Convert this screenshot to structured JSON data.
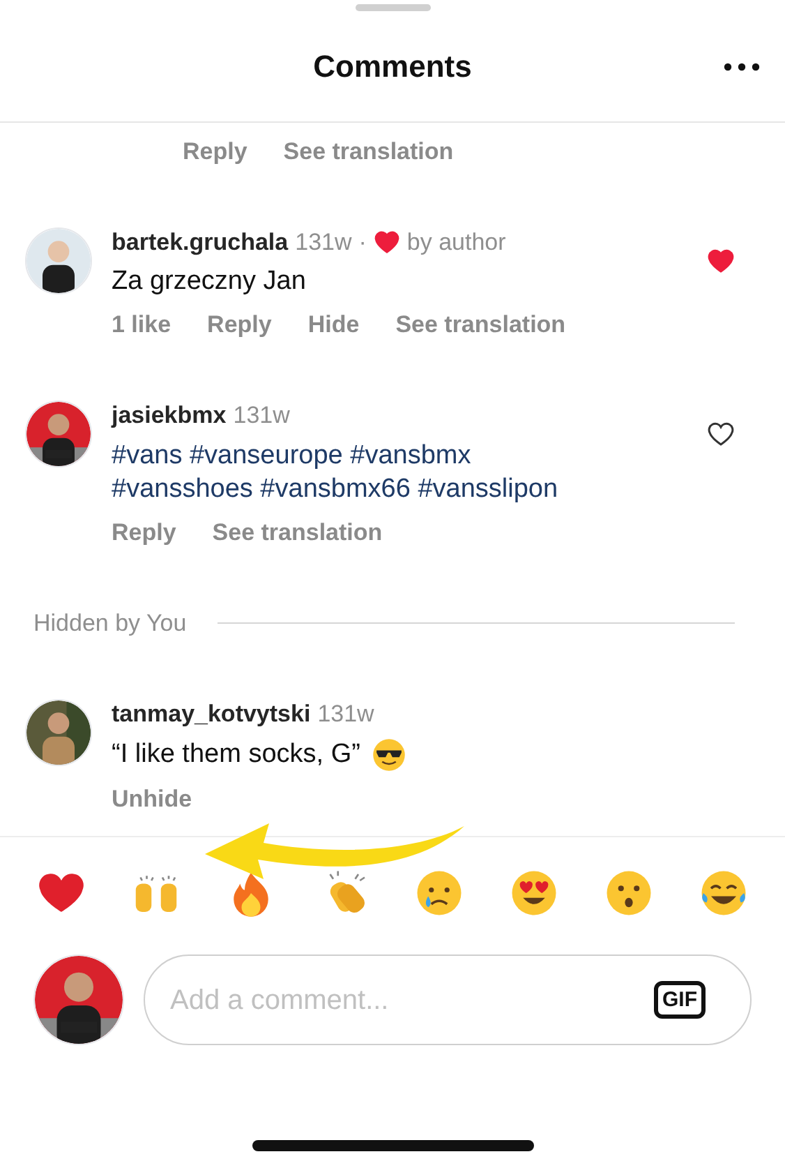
{
  "header": {
    "title": "Comments"
  },
  "top_actions": [
    "Reply",
    "See translation"
  ],
  "comments": [
    {
      "username": "bartek.gruchala",
      "time": "131w",
      "author_liked": true,
      "separator": "·",
      "author_label": "by author",
      "kind": "plain",
      "text": "Za grzeczny Jan",
      "liked": true,
      "actions": [
        "1 like",
        "Reply",
        "Hide",
        "See translation"
      ]
    },
    {
      "username": "jasiekbmx",
      "time": "131w",
      "author_liked": false,
      "kind": "hashtags",
      "text": "#vans #vanseurope #vansbmx #vansshoes #vansbmx66 #vansslipon",
      "liked": false,
      "actions": [
        "Reply",
        "See translation"
      ]
    }
  ],
  "hidden_section": {
    "label": "Hidden by You",
    "comments": [
      {
        "username": "tanmay_kotvytski",
        "time": "131w",
        "text": "“I like them socks, G”",
        "actions": [
          "Unhide"
        ]
      }
    ]
  },
  "composer": {
    "placeholder": "Add a comment...",
    "gif_label": "GIF"
  }
}
